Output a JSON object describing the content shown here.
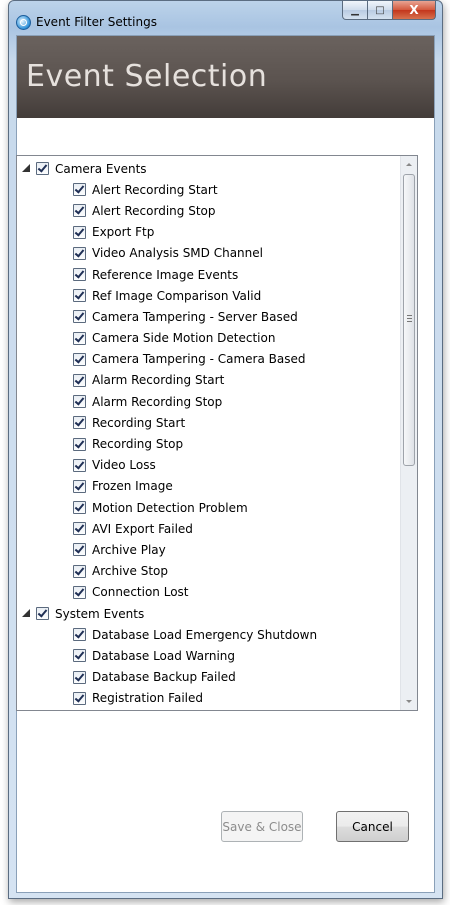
{
  "window": {
    "title": "Event Filter Settings",
    "icon": "app-circle-icon",
    "caption_buttons": {
      "minimize": "▁",
      "maximize": "□",
      "close": "X"
    }
  },
  "banner": {
    "title": "Event Selection"
  },
  "tree": {
    "groups": [
      {
        "label": "Camera Events",
        "expanded": true,
        "checked": true,
        "items": [
          "Alert Recording Start",
          "Alert Recording Stop",
          "Export Ftp",
          "Video Analysis SMD Channel",
          "Reference Image Events",
          "Ref Image Comparison Valid",
          "Camera Tampering - Server Based",
          "Camera Side Motion Detection",
          "Camera Tampering - Camera Based",
          "Alarm Recording Start",
          "Alarm Recording Stop",
          "Recording Start",
          "Recording Stop",
          "Video Loss",
          "Frozen Image",
          "Motion Detection Problem",
          "AVI Export Failed",
          "Archive Play",
          "Archive Stop",
          "Connection Lost"
        ]
      },
      {
        "label": "System Events",
        "expanded": true,
        "checked": true,
        "items": [
          "Database Load Emergency Shutdown",
          "Database Load Warning",
          "Database Backup Failed",
          "Registration Failed"
        ]
      }
    ]
  },
  "buttons": {
    "save_close": "Save & Close",
    "cancel": "Cancel"
  },
  "colors": {
    "banner": "#5b534f",
    "banner_text": "#e6e1dd",
    "frame": "#a9c4e2"
  }
}
